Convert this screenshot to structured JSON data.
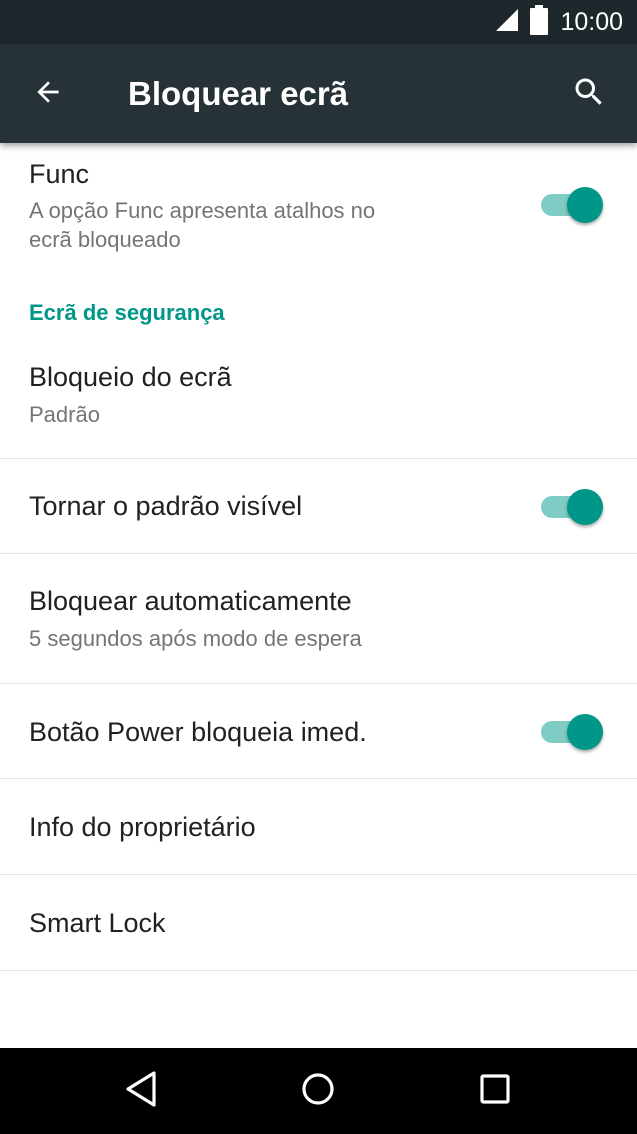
{
  "status_bar": {
    "time": "10:00",
    "icons": [
      "signal-icon",
      "battery-icon"
    ]
  },
  "app_bar": {
    "title": "Bloquear ecrã",
    "back_icon": "arrow-back-icon",
    "search_icon": "search-icon"
  },
  "settings": {
    "func": {
      "title": "Func",
      "subtitle_line1": "A opção Func apresenta atalhos no",
      "subtitle_line2": "ecrã bloqueado",
      "enabled": true
    },
    "section_header": "Ecrã de segurança",
    "screen_lock": {
      "title": "Bloqueio do ecrã",
      "subtitle": "Padrão"
    },
    "pattern_visible": {
      "title": "Tornar o padrão visível",
      "enabled": true
    },
    "auto_lock": {
      "title": "Bloquear automaticamente",
      "subtitle": "5 segundos após modo de espera"
    },
    "power_lock": {
      "title": "Botão Power bloqueia imed.",
      "enabled": true
    },
    "owner_info": {
      "title": "Info do proprietário"
    },
    "smart_lock": {
      "title": "Smart Lock"
    }
  },
  "colors": {
    "status_bar": "#1e272c",
    "app_bar": "#263238",
    "accent": "#009688",
    "toggle_track": "#80cbc4"
  },
  "nav_bar": {
    "icons": [
      "nav-back-icon",
      "nav-home-icon",
      "nav-recents-icon"
    ]
  }
}
